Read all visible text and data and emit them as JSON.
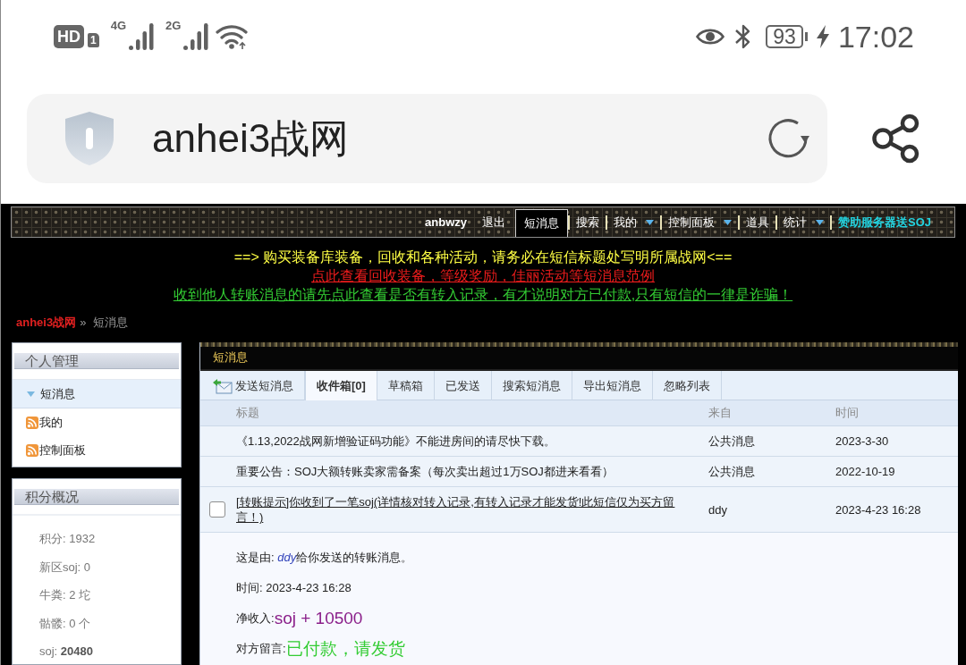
{
  "status_bar": {
    "hd": "HD",
    "sim": "1",
    "networks": [
      {
        "label": "4G"
      },
      {
        "label": "2G"
      }
    ],
    "battery": "93",
    "charging": true,
    "time": "17:02"
  },
  "address_bar": {
    "title": "anhei3战网"
  },
  "nav": {
    "username": "anbwzy",
    "items": [
      {
        "label": "退出",
        "selected": false,
        "dropdown": false
      },
      {
        "label": "短消息",
        "selected": true,
        "dropdown": false
      },
      {
        "label": "搜索",
        "selected": false,
        "dropdown": false
      },
      {
        "label": "我的",
        "selected": false,
        "dropdown": true
      },
      {
        "label": "控制面板",
        "selected": false,
        "dropdown": true
      },
      {
        "label": "道具",
        "selected": false,
        "dropdown": false
      },
      {
        "label": "统计",
        "selected": false,
        "dropdown": true
      }
    ],
    "promo": "赞助服务器送SOJ"
  },
  "notices": [
    {
      "kind": "text",
      "text": "==> 购买装备库装备，回收和各种活动，请务必在短信标题处写明所属战网<==",
      "color": "#ffff44"
    },
    {
      "kind": "link",
      "text": "点此查看回收装备，等级奖励，佳丽活动等短消息范例",
      "color": "#ee1c1c"
    },
    {
      "kind": "link",
      "text": "收到他人转账消息的请先点此查看是否有转入记录，有才说明对方已付款,只有短信的一律是诈骗！",
      "color": "#33cc33"
    }
  ],
  "breadcrumb": {
    "items": [
      {
        "label": "anhei3战网",
        "kind": "home"
      },
      {
        "label": "短消息",
        "kind": "current"
      }
    ],
    "separator": "»"
  },
  "sidebar": {
    "menu": {
      "title": "个人管理",
      "items": [
        {
          "label": "短消息",
          "selected": true
        },
        {
          "label": "我的",
          "selected": false
        },
        {
          "label": "控制面板",
          "selected": false
        }
      ]
    },
    "stats": {
      "title": "积分概况",
      "items": [
        "积分: 1932",
        "新区soj: 0",
        "牛粪: 2 坨",
        "骷髅: 0 个",
        "soj: **20480**"
      ]
    }
  },
  "panel": {
    "title": "短消息",
    "tabs": [
      {
        "label": "发送短消息",
        "kind": "compose",
        "selected": false
      },
      {
        "label": "收件箱[0]",
        "kind": "folder",
        "selected": true
      },
      {
        "label": "草稿箱",
        "kind": "folder",
        "selected": false
      },
      {
        "label": "已发送",
        "kind": "folder",
        "selected": false
      },
      {
        "label": "搜索短消息",
        "kind": "folder",
        "selected": false
      },
      {
        "label": "导出短消息",
        "kind": "folder",
        "selected": false
      },
      {
        "label": "忽略列表",
        "kind": "folder",
        "selected": false
      }
    ],
    "columns": [
      "标题",
      "来自",
      "时间"
    ],
    "rows": [
      {
        "kind": "notice",
        "title": "《1.13,2022战网新增验证码功能》不能进房间的请尽快下载。",
        "from": "公共消息",
        "time": "2023-3-30"
      },
      {
        "kind": "notice",
        "title": "重要公告：SOJ大额转账卖家需备案（每次卖出超过1万SOJ都进来看看）",
        "from": "公共消息",
        "time": "2022-10-19"
      },
      {
        "kind": "message",
        "checked": false,
        "title": "[转账提示]你收到了一笔soj(详情核对转入记录,有转入记录才能发货!此短信仅为买方留言！)",
        "from": "ddy",
        "time": "2023-4-23 16:28"
      }
    ],
    "message": {
      "lines": [
        {
          "kind": "sender",
          "before": "这是由: ",
          "name": "ddy",
          "after": "给你发送的转账消息。"
        },
        {
          "kind": "text",
          "text": "时间: 2023-4-23 16:28"
        },
        {
          "kind": "amount",
          "label": "净收入:",
          "value": "soj + 10500"
        },
        {
          "kind": "note",
          "label": "对方留言:",
          "value": "已付款，请发货"
        }
      ]
    }
  }
}
